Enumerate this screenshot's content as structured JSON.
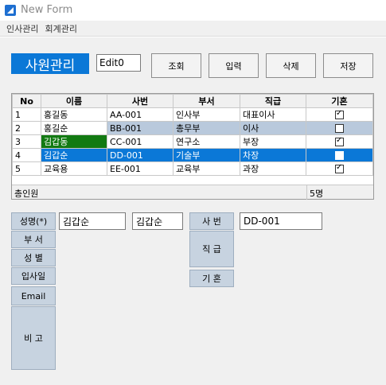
{
  "window": {
    "title": "New Form"
  },
  "menu": {
    "items": [
      "인사관리",
      "회계관리"
    ]
  },
  "header": {
    "title": "사원관리",
    "edit_value": "Edit0"
  },
  "toolbar": {
    "search": "조회",
    "input": "입력",
    "delete": "삭제",
    "save": "저장"
  },
  "grid": {
    "columns": [
      "No",
      "이름",
      "사번",
      "부서",
      "직급",
      "기혼"
    ],
    "rows": [
      {
        "no": "1",
        "name": "홍길동",
        "id": "AA-001",
        "dept": "인사부",
        "rank": "대표이사",
        "married": true
      },
      {
        "no": "2",
        "name": "홍길순",
        "id": "BB-001",
        "dept": "총무부",
        "rank": "이사",
        "married": false
      },
      {
        "no": "3",
        "name": "김갑동",
        "id": "CC-001",
        "dept": "연구소",
        "rank": "부장",
        "married": true
      },
      {
        "no": "4",
        "name": "김갑순",
        "id": "DD-001",
        "dept": "기술부",
        "rank": "차장",
        "married": false
      },
      {
        "no": "5",
        "name": "교육용",
        "id": "EE-001",
        "dept": "교육부",
        "rank": "과장",
        "married": true
      }
    ],
    "footer_label": "총인원",
    "footer_count": "5명"
  },
  "form": {
    "labels": {
      "name": "성명(*)",
      "dept": "부 서",
      "gender": "성 별",
      "hire_date": "입사일",
      "email": "Email",
      "note": "비 고",
      "emp_no": "사 번",
      "rank": "직 급",
      "married": "기 혼"
    },
    "values": {
      "name_1": "김갑순",
      "name_2": "김갑순",
      "emp_no": "DD-001"
    }
  },
  "colors": {
    "accent": "#0b78d7",
    "label_bg": "#c7d3e0",
    "highlight_green": "#127a12"
  }
}
